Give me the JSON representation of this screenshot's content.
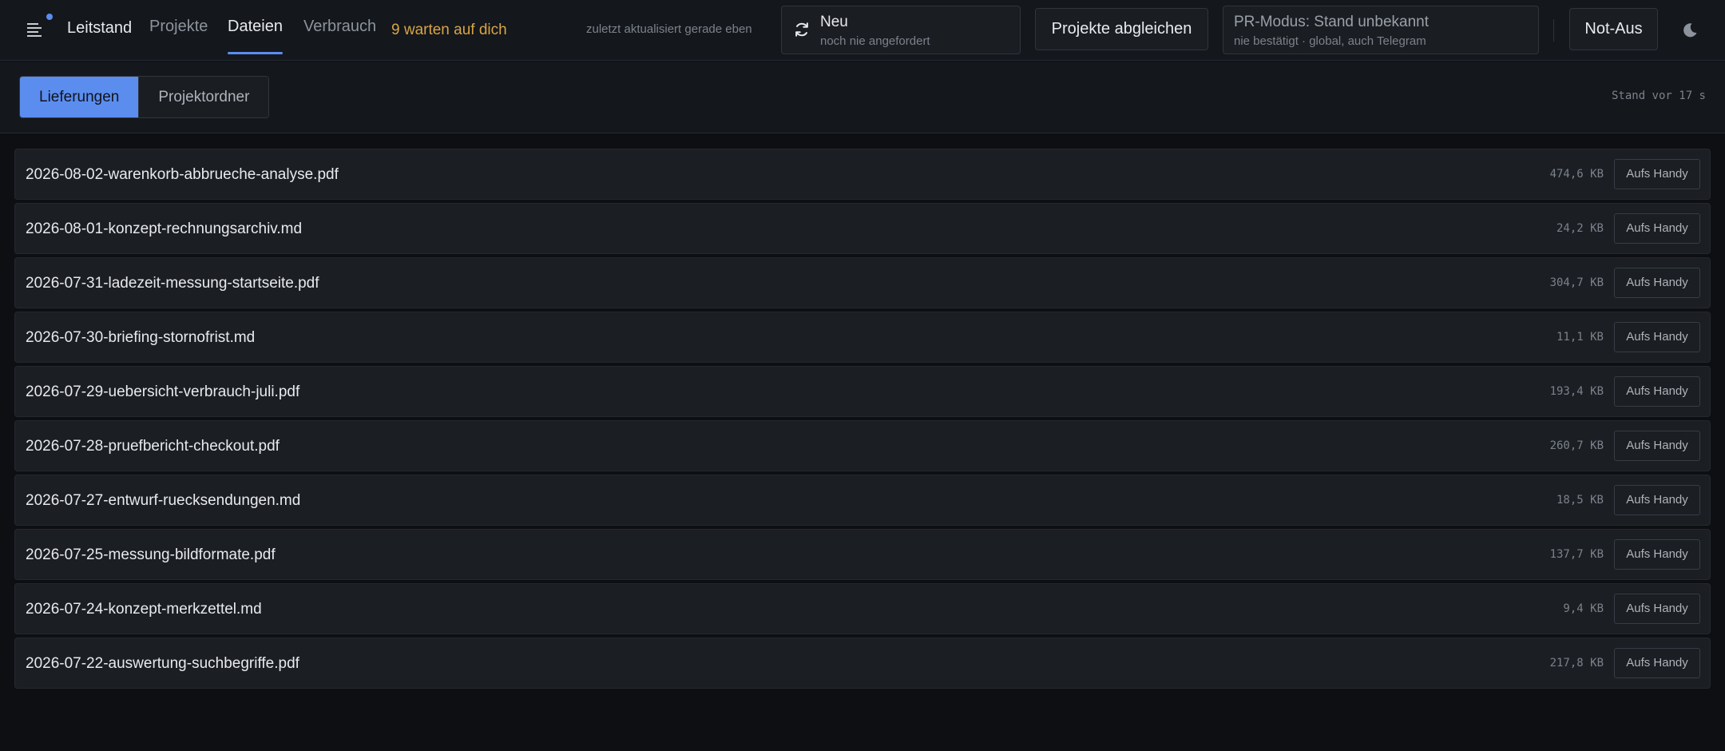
{
  "header": {
    "brand": "Leitstand",
    "tabs": [
      {
        "label": "Projekte"
      },
      {
        "label": "Dateien"
      },
      {
        "label": "Verbrauch"
      }
    ],
    "waiting_label": "9 warten auf dich",
    "updated_label": "zuletzt aktualisiert gerade eben",
    "new_box": {
      "title": "Neu",
      "subtitle": "noch nie angefordert"
    },
    "sync_label": "Projekte abgleichen",
    "pr_box": {
      "title": "PR-Modus: Stand unbekannt",
      "subtitle": "nie bestätigt · global, auch Telegram"
    },
    "stop_label": "Not-Aus"
  },
  "subbar": {
    "segments": [
      {
        "label": "Lieferungen"
      },
      {
        "label": "Projektordner"
      }
    ],
    "stand": "Stand vor 17 s"
  },
  "files": [
    {
      "name": "2026-08-02-warenkorb-abbrueche-analyse.pdf",
      "size": "474,6 KB",
      "action": "Aufs Handy"
    },
    {
      "name": "2026-08-01-konzept-rechnungsarchiv.md",
      "size": "24,2 KB",
      "action": "Aufs Handy"
    },
    {
      "name": "2026-07-31-ladezeit-messung-startseite.pdf",
      "size": "304,7 KB",
      "action": "Aufs Handy"
    },
    {
      "name": "2026-07-30-briefing-stornofrist.md",
      "size": "11,1 KB",
      "action": "Aufs Handy"
    },
    {
      "name": "2026-07-29-uebersicht-verbrauch-juli.pdf",
      "size": "193,4 KB",
      "action": "Aufs Handy"
    },
    {
      "name": "2026-07-28-pruefbericht-checkout.pdf",
      "size": "260,7 KB",
      "action": "Aufs Handy"
    },
    {
      "name": "2026-07-27-entwurf-ruecksendungen.md",
      "size": "18,5 KB",
      "action": "Aufs Handy"
    },
    {
      "name": "2026-07-25-messung-bildformate.pdf",
      "size": "137,7 KB",
      "action": "Aufs Handy"
    },
    {
      "name": "2026-07-24-konzept-merkzettel.md",
      "size": "9,4 KB",
      "action": "Aufs Handy"
    },
    {
      "name": "2026-07-22-auswertung-suchbegriffe.pdf",
      "size": "217,8 KB",
      "action": "Aufs Handy"
    }
  ],
  "icons": {
    "menu": "menu-icon",
    "notification": "notification-dot",
    "refresh": "refresh-icon",
    "theme": "moon-icon"
  },
  "colors": {
    "accent": "#5b8def",
    "warning": "#d9a545"
  }
}
